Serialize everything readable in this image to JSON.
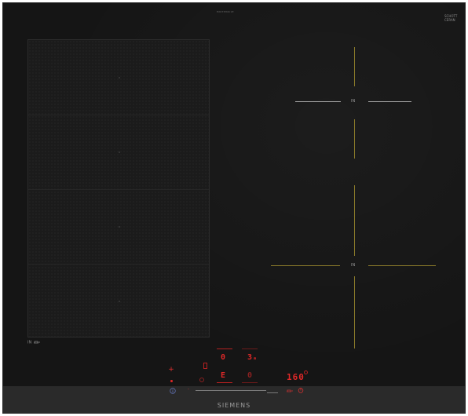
{
  "hob": {
    "model_code": "EX675HXC1E",
    "schott": {
      "line1": "SCHOTT",
      "line2": "CERAN",
      "line3": ""
    },
    "brand": "SIEMENS"
  },
  "flex_zone": {
    "label": "IN"
  },
  "zones": {
    "rear_right_label": "IN",
    "front_right_label": "IN"
  },
  "display": {
    "flex_rear_level": "0",
    "flex_front_level": "E",
    "front_right_level": "0",
    "rear_right_level": "3",
    "rear_right_sub": "a",
    "timer": "160"
  },
  "controls": {
    "plus_label": "+",
    "minus_label": "-"
  },
  "colors": {
    "glass": "#151515",
    "control_strip": "#2a2a2a",
    "indicator_red": "#e02828",
    "zone_marking": "#8a7a2a"
  }
}
